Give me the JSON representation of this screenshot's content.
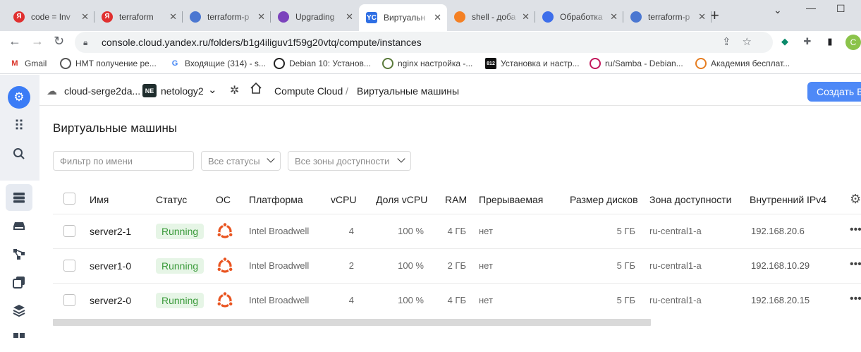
{
  "browser": {
    "tabs": [
      {
        "title": "code = Inv",
        "icon_label": "Я",
        "icon_color": "#e02f2f"
      },
      {
        "title": "terraform",
        "icon_label": "Я",
        "icon_color": "#e02f2f"
      },
      {
        "title": "terraform-p",
        "icon_label": "",
        "icon_color": "#4b77d1"
      },
      {
        "title": "Upgrading",
        "icon_label": "",
        "icon_color": "#7b42bc"
      },
      {
        "title": "Виртуальн",
        "icon_label": "YC",
        "icon_color": "#2f6fe4"
      },
      {
        "title": "shell - доба",
        "icon_label": "",
        "icon_color": "#f48024"
      },
      {
        "title": "Обработка",
        "icon_label": "",
        "icon_color": "#3d6eea"
      },
      {
        "title": "terraform-p",
        "icon_label": "",
        "icon_color": "#4b77d1"
      }
    ],
    "active_tab_index": 4,
    "url": "console.cloud.yandex.ru/folders/b1g4iliguv1f59g20vtq/compute/instances",
    "profile_initial": "C",
    "bookmarks": [
      {
        "label": "Gmail",
        "icon_label": "M",
        "icon_color": "#d93025"
      },
      {
        "label": "НМТ получение ре...",
        "icon_label": "",
        "icon_color": "#555555"
      },
      {
        "label": "Входящие (314) - s...",
        "icon_label": "G",
        "icon_color": "#4285f4"
      },
      {
        "label": "Debian 10: Установ...",
        "icon_label": "",
        "icon_color": "#222222"
      },
      {
        "label": "nginx настройка -...",
        "icon_label": "",
        "icon_color": "#5a7a3a"
      },
      {
        "label": "Установка и настр...",
        "icon_label": "812",
        "icon_color": "#111111"
      },
      {
        "label": "ru/Samba - Debian...",
        "icon_label": "",
        "icon_color": "#c2185b"
      },
      {
        "label": "Академия бесплат...",
        "icon_label": "",
        "icon_color": "#e67e22"
      }
    ]
  },
  "header": {
    "cloud": "cloud-serge2da...",
    "folder_badge": "NE",
    "folder": "netology2",
    "service": "Compute Cloud",
    "separator": "/",
    "page": "Виртуальные машины",
    "create_button": "Создать ВМ"
  },
  "main": {
    "title": "Виртуальные машины",
    "filters": {
      "name_placeholder": "Фильтр по имени",
      "status": "Все статусы",
      "zone": "Все зоны доступности"
    },
    "columns": {
      "name": "Имя",
      "status": "Статус",
      "os": "ОС",
      "platform": "Платформа",
      "vcpu": "vCPU",
      "vcpu_share": "Доля vCPU",
      "ram": "RAM",
      "preemptible": "Прерываемая",
      "disk": "Размер дисков",
      "zone": "Зона доступности",
      "ip": "Внутренний IPv4"
    },
    "rows": [
      {
        "name": "server2-1",
        "status": "Running",
        "os": "ubuntu-icon",
        "platform": "Intel Broadwell",
        "vcpu": "4",
        "vcpu_share": "100 %",
        "ram": "4 ГБ",
        "preemptible": "нет",
        "disk": "5 ГБ",
        "zone": "ru-central1-a",
        "ip": "192.168.20.6"
      },
      {
        "name": "server1-0",
        "status": "Running",
        "os": "ubuntu-icon",
        "platform": "Intel Broadwell",
        "vcpu": "2",
        "vcpu_share": "100 %",
        "ram": "2 ГБ",
        "preemptible": "нет",
        "disk": "5 ГБ",
        "zone": "ru-central1-a",
        "ip": "192.168.10.29"
      },
      {
        "name": "server2-0",
        "status": "Running",
        "os": "ubuntu-icon",
        "platform": "Intel Broadwell",
        "vcpu": "4",
        "vcpu_share": "100 %",
        "ram": "4 ГБ",
        "preemptible": "нет",
        "disk": "5 ГБ",
        "zone": "ru-central1-a",
        "ip": "192.168.20.15"
      }
    ]
  },
  "colors": {
    "accent": "#4e89f7",
    "running_bg": "#e6f5e6",
    "running_text": "#3a9a3a",
    "ubuntu": "#e95420"
  }
}
